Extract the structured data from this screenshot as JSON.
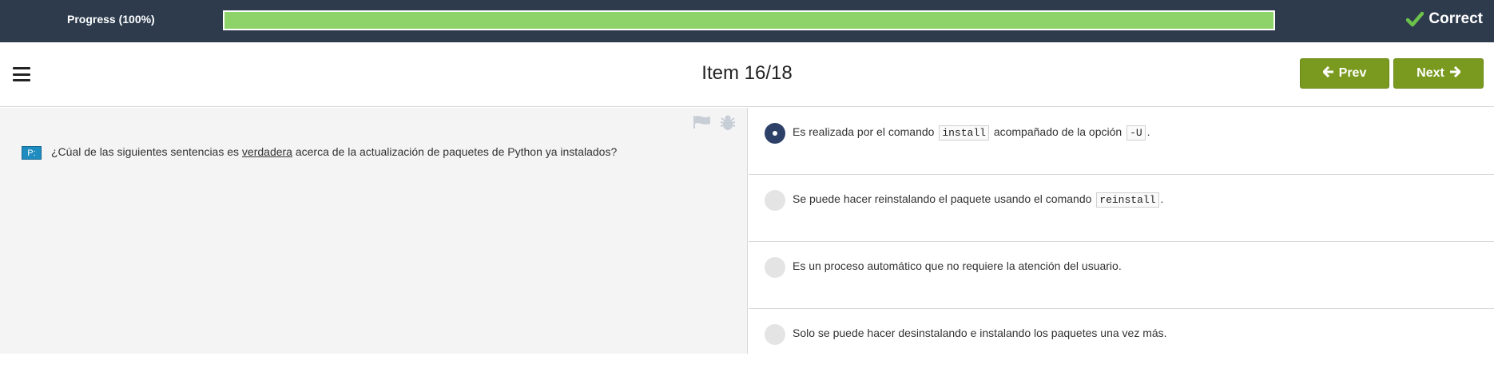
{
  "progress": {
    "label": "Progress (100%)",
    "percent": 100,
    "fill_color": "#8ed26a",
    "status": "Correct",
    "status_icon": "checkmark-icon"
  },
  "header": {
    "title": "Item 16/18",
    "prev_label": "Prev",
    "next_label": "Next",
    "menu_icon": "hamburger-menu-icon",
    "button_color": "#7a9a1f"
  },
  "question": {
    "badge": "P:",
    "text_before": "¿Cúal de las siguientes sentencias es ",
    "text_emphasis": "verdadera",
    "text_after": " acerca de la actualización de paquetes de Python ya instalados?",
    "flag_icon": "flag-icon",
    "bug_icon": "bug-icon"
  },
  "answers": [
    {
      "selected": true,
      "before": "Es realizada por el comando ",
      "code1": "install",
      "middle": " acompañado de la opción ",
      "code2": "-U",
      "after": "."
    },
    {
      "selected": false,
      "before": "Se puede hacer reinstalando el paquete usando el comando ",
      "code1": "reinstall",
      "after": "."
    },
    {
      "selected": false,
      "text": "Es un proceso automático que no requiere la atención del usuario."
    },
    {
      "selected": false,
      "text": "Solo se puede hacer desinstalando e instalando los paquetes una vez más."
    }
  ]
}
